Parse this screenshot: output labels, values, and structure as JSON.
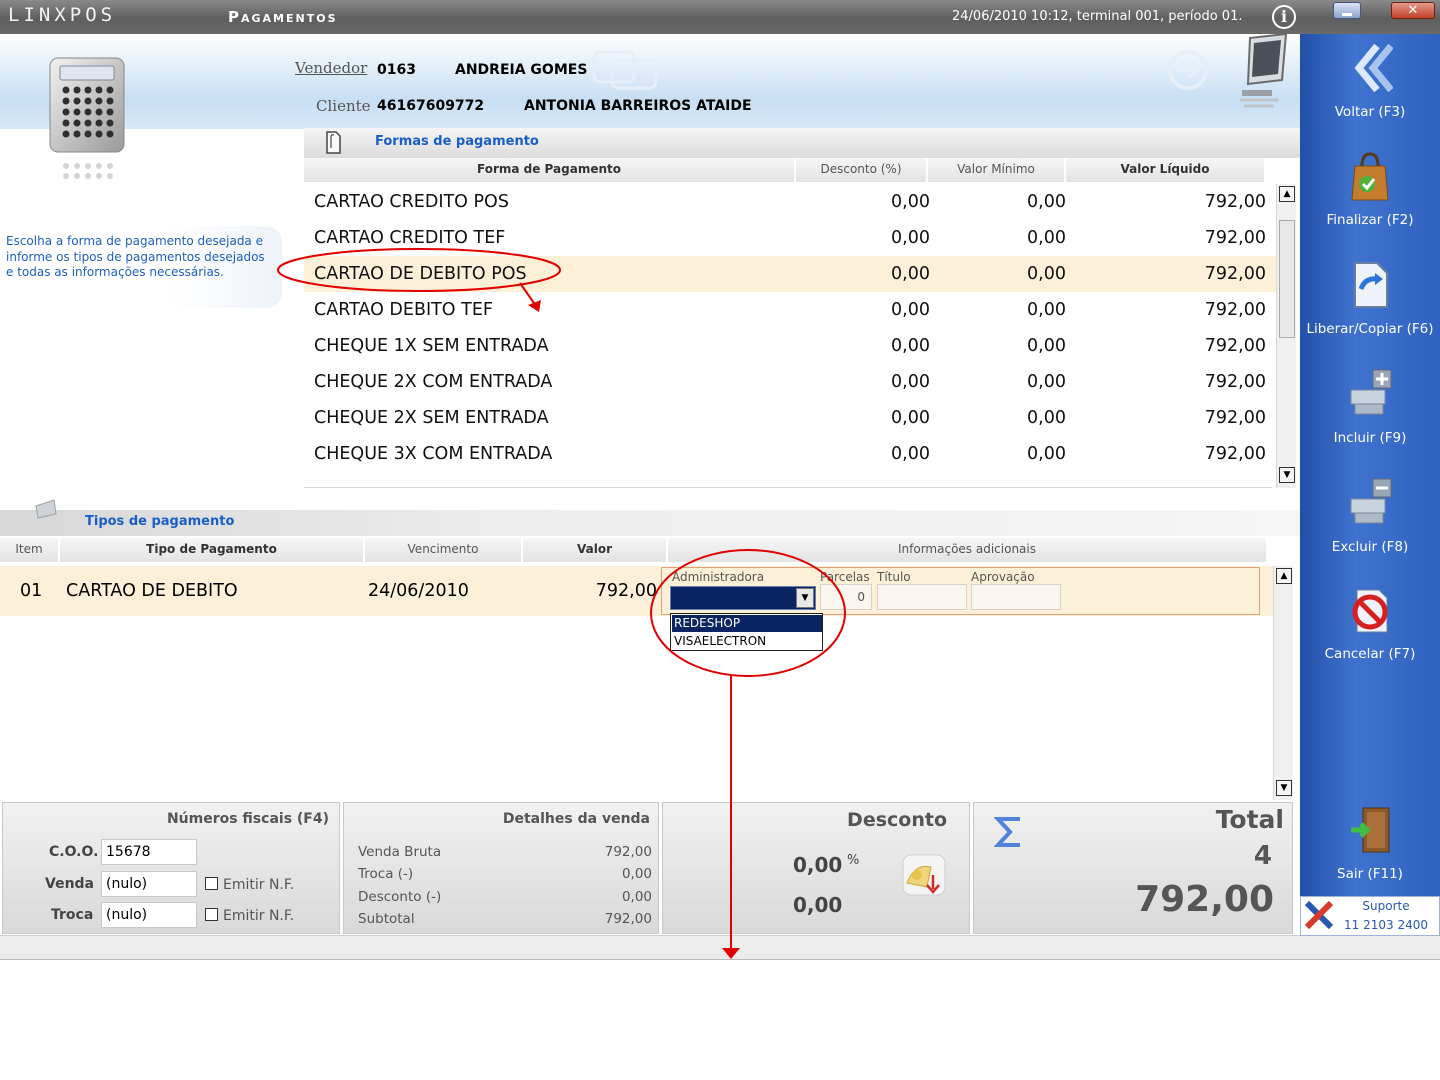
{
  "titlebar": {
    "app_logo": "LINXPOS",
    "screen_title": "Pagamentos",
    "status": "24/06/2010 10:12, terminal 001, período 01."
  },
  "header": {
    "vendedor_label": "Vendedor",
    "vendedor_code": "0163",
    "vendedor_name": "ANDREIA GOMES",
    "cliente_label": "Cliente",
    "cliente_code": "46167609772",
    "cliente_name": "ANTONIA BARREIROS ATAIDE"
  },
  "hint": {
    "text": "Escolha a forma de pagamento desejada e informe os tipos de pagamentos desejados e todas as informações necessárias."
  },
  "formas": {
    "section_title": "Formas de pagamento",
    "columns": [
      "Forma de Pagamento",
      "Desconto (%)",
      "Valor Mínimo",
      "Valor Líquido"
    ],
    "rows": [
      {
        "forma": "CARTAO CREDITO POS",
        "desconto": "0,00",
        "minimo": "0,00",
        "liquido": "792,00"
      },
      {
        "forma": "CARTAO CREDITO TEF",
        "desconto": "0,00",
        "minimo": "0,00",
        "liquido": "792,00"
      },
      {
        "forma": "CARTAO DE DEBITO POS",
        "desconto": "0,00",
        "minimo": "0,00",
        "liquido": "792,00"
      },
      {
        "forma": "CARTAO DEBITO TEF",
        "desconto": "0,00",
        "minimo": "0,00",
        "liquido": "792,00"
      },
      {
        "forma": "CHEQUE 1X SEM ENTRADA",
        "desconto": "0,00",
        "minimo": "0,00",
        "liquido": "792,00"
      },
      {
        "forma": "CHEQUE 2X COM ENTRADA",
        "desconto": "0,00",
        "minimo": "0,00",
        "liquido": "792,00"
      },
      {
        "forma": "CHEQUE 2X SEM ENTRADA",
        "desconto": "0,00",
        "minimo": "0,00",
        "liquido": "792,00"
      },
      {
        "forma": "CHEQUE 3X COM ENTRADA",
        "desconto": "0,00",
        "minimo": "0,00",
        "liquido": "792,00"
      }
    ]
  },
  "tipos": {
    "section_title": "Tipos de pagamento",
    "columns": [
      "Item",
      "Tipo de Pagamento",
      "Vencimento",
      "Valor",
      "Informações adicionais"
    ],
    "row": {
      "item": "01",
      "tipo": "CARTAO DE DEBITO",
      "vencimento": "24/06/2010",
      "valor": "792,00"
    },
    "info_labels": {
      "administradora": "Administradora",
      "parcelas": "Parcelas",
      "titulo": "Título",
      "aprovacao": "Aprovação"
    },
    "parcelas_value": "0",
    "admin_options": [
      "REDESHOP",
      "VISAELECTRON"
    ]
  },
  "fiscal": {
    "title": "Números fiscais (F4)",
    "coo_label": "C.O.O.",
    "coo_value": "15678",
    "venda_label": "Venda",
    "venda_value": "(nulo)",
    "troca_label": "Troca",
    "troca_value": "(nulo)",
    "emitir_label": "Emitir N.F."
  },
  "detalhes": {
    "title": "Detalhes da venda",
    "items": [
      {
        "label": "Venda Bruta",
        "value": "792,00"
      },
      {
        "label": "Troca (-)",
        "value": "0,00"
      },
      {
        "label": "Desconto (-)",
        "value": "0,00"
      },
      {
        "label": "Subtotal",
        "value": "792,00"
      }
    ]
  },
  "desconto": {
    "title": "Desconto",
    "percent": "0,00",
    "percent_sign": "%",
    "value": "0,00"
  },
  "total": {
    "title": "Total",
    "count": "4",
    "value": "792,00"
  },
  "sidebar": {
    "buttons": [
      "Voltar (F3)",
      "Finalizar (F2)",
      "Liberar/Copiar (F6)",
      "Incluir (F9)",
      "Excluir (F8)",
      "Cancelar (F7)",
      "Sair (F11)"
    ],
    "support_title": "Suporte",
    "support_phone": "11 2103 2400"
  },
  "colors": {
    "accent_blue": "#1a5fc7",
    "selected_row": "#fdf0d8",
    "sidebar_blue": "#3f73cf",
    "annotation_red": "#e00000"
  }
}
